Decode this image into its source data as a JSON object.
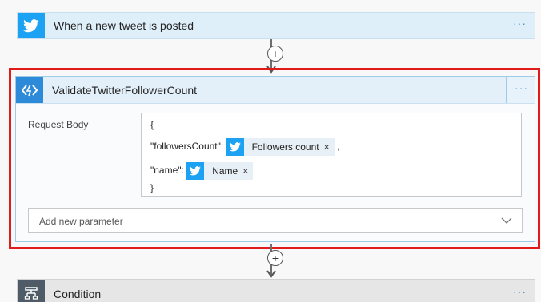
{
  "trigger": {
    "title": "When a new tweet is posted",
    "menu": "···",
    "icon": "twitter-bird-icon",
    "color": "#1da1f2"
  },
  "action": {
    "title": "ValidateTwitterFollowerCount",
    "menu": "···",
    "icon": "function-code-icon",
    "color": "#2d8ad8",
    "request_body_label": "Request Body",
    "body": {
      "open": "{",
      "close": "}",
      "field1_key": "\"followersCount\":",
      "field1_token": "Followers count",
      "field1_comma": ",",
      "field2_key": "\"name\":",
      "field2_token": "Name",
      "token_close": "×"
    },
    "add_parameter_placeholder": "Add new parameter"
  },
  "condition": {
    "title": "Condition",
    "menu": "···",
    "icon": "condition-icon",
    "color": "#4f5b66"
  },
  "highlight_color": "#e11a1a"
}
